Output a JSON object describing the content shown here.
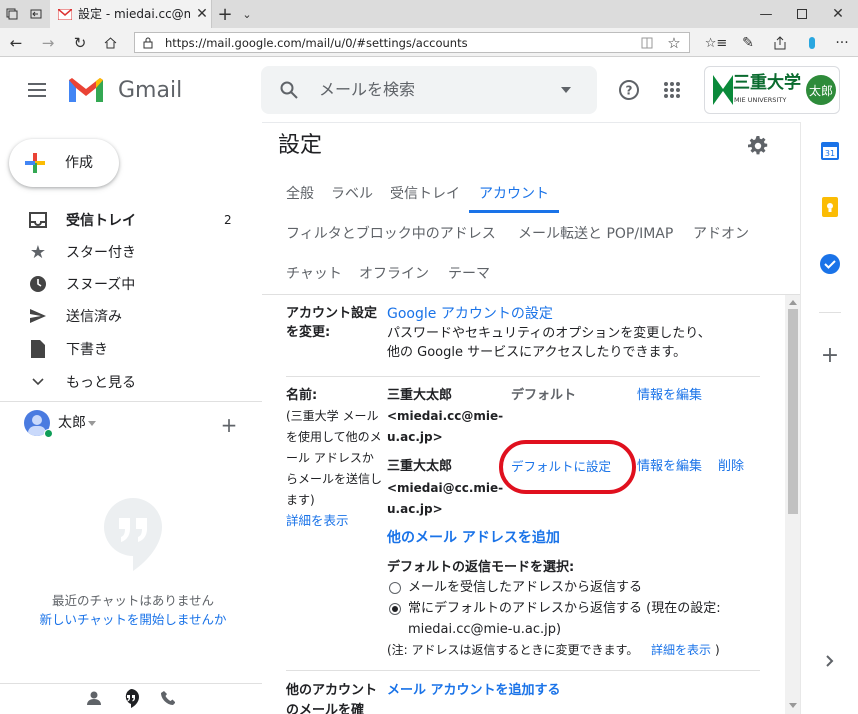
{
  "browser": {
    "tab_title": "設定 - miedai.cc@mie-u",
    "url": "https://mail.google.com/mail/u/0/#settings/accounts"
  },
  "app": {
    "name": "Gmail",
    "search_placeholder": "メールを検索",
    "avatar_text": "太郎",
    "logo_text": "三重大学",
    "logo_sub": "MIE UNIVERSITY"
  },
  "sidebar": {
    "compose": "作成",
    "items": [
      {
        "label": "受信トレイ",
        "count": "2"
      },
      {
        "label": "スター付き"
      },
      {
        "label": "スヌーズ中"
      },
      {
        "label": "送信済み"
      },
      {
        "label": "下書き"
      },
      {
        "label": "もっと見る"
      }
    ],
    "user": "太郎",
    "chat_empty": "最近のチャットはありません",
    "chat_start": "新しいチャットを開始しませんか"
  },
  "settings": {
    "title": "設定",
    "tabs_row1": [
      "全般",
      "ラベル",
      "受信トレイ",
      "アカウント"
    ],
    "tabs_row2": [
      "フィルタとブロック中のアドレス",
      "メール転送と POP/IMAP",
      "アドオン"
    ],
    "tabs_row3": [
      "チャット",
      "オフライン",
      "テーマ"
    ],
    "account_change_label_1": "アカウント設定",
    "account_change_label_2": "を変更:",
    "google_account_link": "Google アカウントの設定",
    "google_account_desc_1": "パスワードやセキュリティのオプションを変更したり、",
    "google_account_desc_2": "他の Google サービスにアクセスしたりできます。",
    "name_label": "名前:",
    "name_note": [
      "(三重大学 メール",
      "を使用して他のメ",
      "ール アドレスか",
      "らメールを送信し",
      "ます)"
    ],
    "details_link": "詳細を表示",
    "addr1_name": "三重大太郎",
    "addr1_email_1": "<miedai.cc@mie-",
    "addr1_email_2": "u.ac.jp>",
    "default_label": "デフォルト",
    "edit_info": "情報を編集",
    "addr2_name": "三重大太郎",
    "addr2_email_1": "<miedai@cc.mie-",
    "addr2_email_2": "u.ac.jp>",
    "make_default": "デフォルトに設定",
    "delete": "削除",
    "add_other": "他のメール アドレスを追加",
    "reply_mode_title": "デフォルトの返信モードを選択:",
    "reply_opt1": "メールを受信したアドレスから返信する",
    "reply_opt2_1": "常にデフォルトのアドレスから返信する (現在の設定:",
    "reply_opt2_2": "miedai.cc@mie-u.ac.jp)",
    "reply_note": "(注: アドレスは返信するときに変更できます。",
    "reply_note_link": "詳細を表示",
    "reply_note_end": ")",
    "other_account_label_1": "他のアカウント",
    "other_account_label_2": "のメールを確",
    "add_mail_account": "メール アカウントを追加する"
  }
}
